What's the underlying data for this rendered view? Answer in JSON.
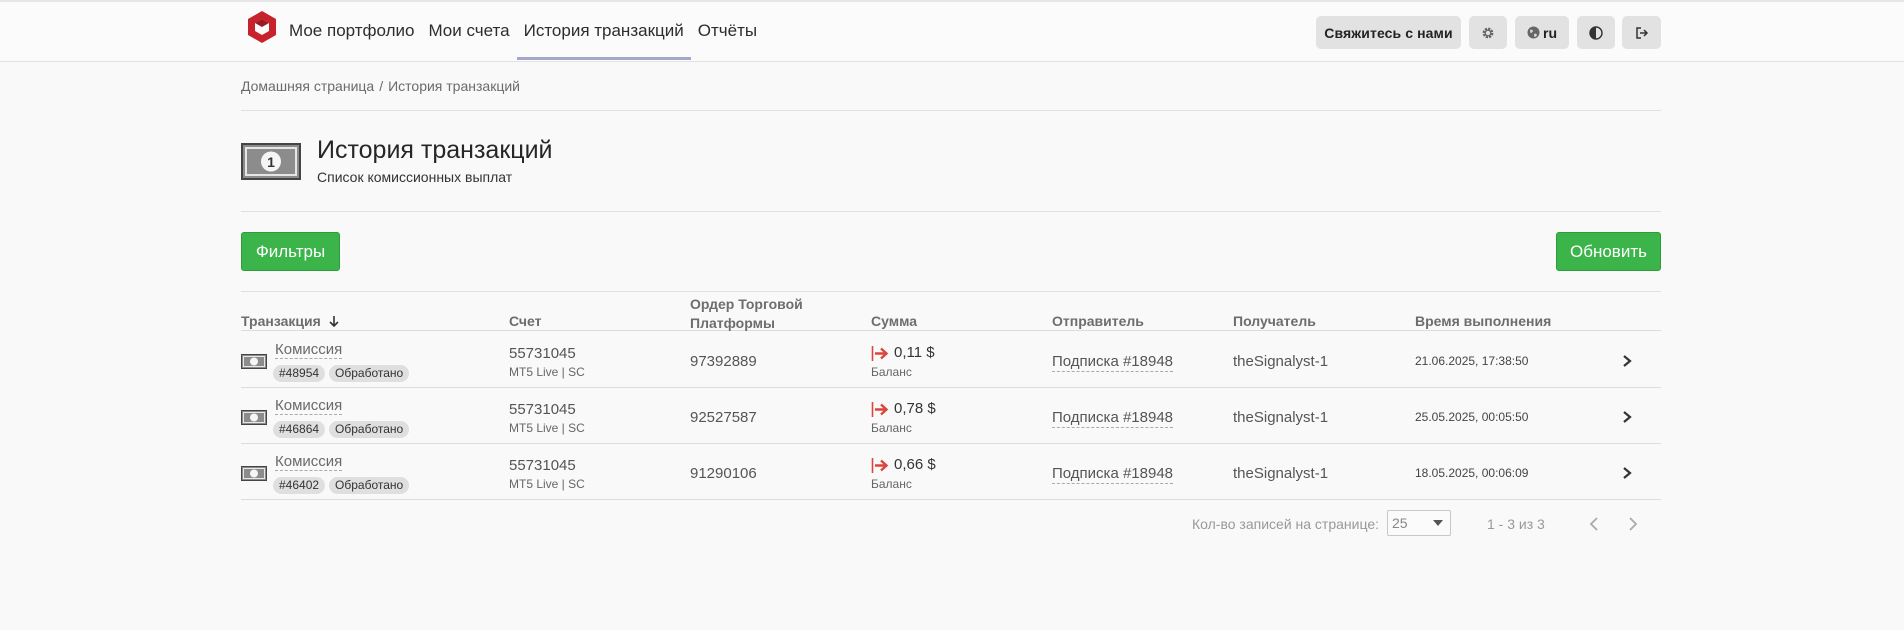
{
  "header": {
    "nav": [
      "Мое портфолио",
      "Мои счета",
      "История транзакций",
      "Отчёты"
    ],
    "active_nav": 2,
    "contact_label": "Свяжитесь с нами",
    "lang_label": "ru",
    "brand_color": "#c8232c"
  },
  "breadcrumb": {
    "home": "Домашняя страница",
    "separator": "/",
    "current": "История транзакций"
  },
  "page": {
    "title": "История транзакций",
    "subtitle": "Список комиссионных выплат",
    "icon_digit": "1"
  },
  "toolbar": {
    "filters_label": "Фильтры",
    "refresh_label": "Обновить",
    "button_color": "#3bb54a"
  },
  "table": {
    "headers": {
      "transaction": "Транзакция",
      "account": "Счет",
      "order_line1": "Ордер Торговой",
      "order_line2": "Платформы",
      "amount": "Сумма",
      "sender": "Отправитель",
      "recipient": "Получатель",
      "time": "Время выполнения"
    },
    "rows": [
      {
        "type": "Комиссия",
        "id": "#48954",
        "status": "Обработано",
        "account": "55731045",
        "account_sub": "MT5 Live | SC",
        "order": "97392889",
        "amount": "0,11 $",
        "amount_sub": "Баланс",
        "sender": "Подписка #18948",
        "recipient": "theSignalyst-1",
        "time": "21.06.2025, 17:38:50"
      },
      {
        "type": "Комиссия",
        "id": "#46864",
        "status": "Обработано",
        "account": "55731045",
        "account_sub": "MT5 Live | SC",
        "order": "92527587",
        "amount": "0,78 $",
        "amount_sub": "Баланс",
        "sender": "Подписка #18948",
        "recipient": "theSignalyst-1",
        "time": "25.05.2025, 00:05:50"
      },
      {
        "type": "Комиссия",
        "id": "#46402",
        "status": "Обработано",
        "account": "55731045",
        "account_sub": "MT5 Live | SC",
        "order": "91290106",
        "amount": "0,66 $",
        "amount_sub": "Баланс",
        "sender": "Подписка #18948",
        "recipient": "theSignalyst-1",
        "time": "18.05.2025, 00:06:09"
      }
    ]
  },
  "pager": {
    "per_page_label": "Кол-во записей на странице:",
    "per_page_value": "25",
    "range": "1 - 3 из 3"
  },
  "icons": {
    "outgoing_arrow_color": "#d9463b"
  }
}
